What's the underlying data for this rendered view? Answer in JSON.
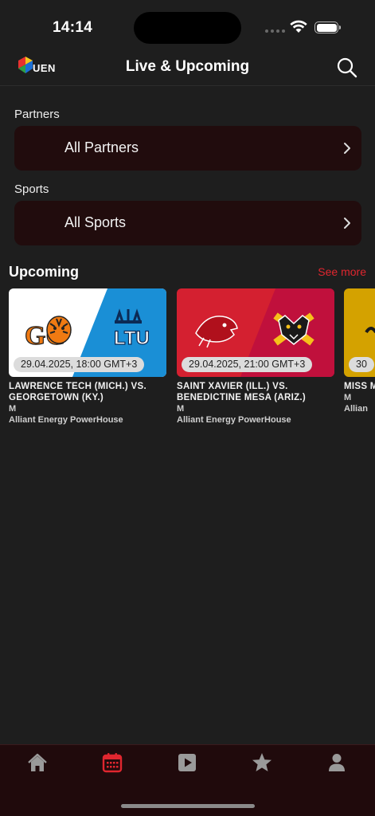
{
  "status_bar": {
    "time": "14:14"
  },
  "header": {
    "logo_text": "UEN",
    "title": "Live & Upcoming"
  },
  "partners": {
    "label": "Partners",
    "value": "All Partners"
  },
  "sports": {
    "label": "Sports",
    "value": "All Sports"
  },
  "upcoming": {
    "title": "Upcoming",
    "see_more": "See more",
    "cards": [
      {
        "date": "29.04.2025, 18:00 GMT+3",
        "title": "LAWRENCE TECH (MICH.) VS. GEORGETOWN (KY.)",
        "gender": "M",
        "venue": "Alliant Energy PowerHouse",
        "colors": [
          "#ffffff",
          "#1a8fd6"
        ]
      },
      {
        "date": "29.04.2025, 21:00 GMT+3",
        "title": "SAINT XAVIER (ILL.) VS. BENEDICTINE MESA (ARIZ.)",
        "gender": "M",
        "venue": "Alliant Energy PowerHouse",
        "colors": [
          "#d42030",
          "#c0103c"
        ]
      },
      {
        "date": "30",
        "title": "MISS MERC",
        "gender": "M",
        "venue": "Allian",
        "colors": [
          "#d4a200",
          "#d4a200"
        ]
      }
    ]
  },
  "tab_bar": {
    "tabs": [
      {
        "name": "home-icon",
        "active": false
      },
      {
        "name": "calendar-icon",
        "active": true
      },
      {
        "name": "play-icon",
        "active": false
      },
      {
        "name": "star-icon",
        "active": false
      },
      {
        "name": "profile-icon",
        "active": false
      }
    ],
    "active_color": "#e0262f",
    "inactive_color": "#9a9a9a"
  }
}
